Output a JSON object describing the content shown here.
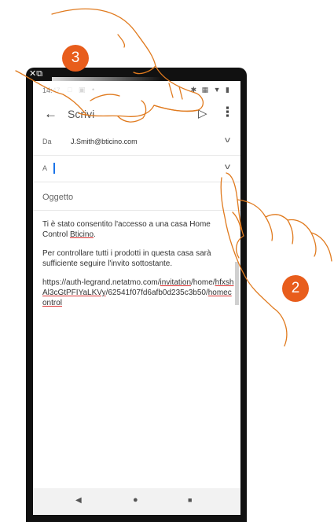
{
  "status_bar": {
    "time": "14:47",
    "left_icons": "□ ▣ •",
    "right_icons": "✱ ▦ ▼ ▮"
  },
  "toolbar": {
    "title": "Scrivi",
    "back_icon": "arrow-left-icon",
    "send_icon": "send-icon",
    "more_icon": "more-vert-icon"
  },
  "compose": {
    "from_label": "Da",
    "from_value": "J.Smith@bticino.com",
    "to_label": "A",
    "to_value": "",
    "subject_placeholder": "Oggetto"
  },
  "body": {
    "line1_pre": "Ti è stato consentito l'accesso a una casa Home Control ",
    "line1_brand": "Bticino",
    "line1_post": ".",
    "line2": "Per controllare tutti i prodotti in questa casa sarà sufficiente seguire l'invito sottostante.",
    "link_part1": "https://auth-legrand.netatmo.com/",
    "link_part2": "invitation",
    "link_part3": "/home/",
    "link_part4": "hfxshAl3cGtPFIYaLKVy",
    "link_part5": "/62541f07fd6afb0d235c3b50/",
    "link_part6": "homecontrol"
  },
  "nav_bar": {
    "back": "◀",
    "home": "●",
    "recent": "■"
  },
  "steps": {
    "step_a": "3",
    "step_b": "2"
  },
  "colors": {
    "accent": "#e85d1c",
    "cursor": "#1a73e8"
  }
}
